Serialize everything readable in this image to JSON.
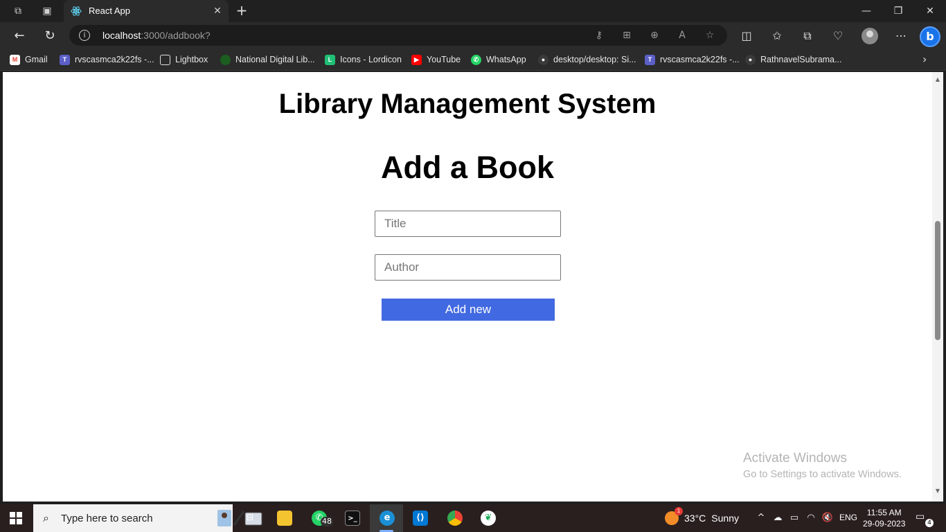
{
  "browser": {
    "tab_title": "React App",
    "url_host": "localhost",
    "url_path": ":3000/addbook?",
    "new_tab_symbol": "+",
    "close_symbol": "✕"
  },
  "bookmarks": [
    {
      "label": "Gmail",
      "icon": "gmail-icon",
      "color": "#ea4335"
    },
    {
      "label": "rvscasmca2k22fs -...",
      "icon": "teams-icon",
      "color": "#5b5fc7"
    },
    {
      "label": "Lightbox",
      "icon": "page-icon",
      "color": "#2b2b2b"
    },
    {
      "label": "National Digital Lib...",
      "icon": "ndl-icon",
      "color": "#1b5e20"
    },
    {
      "label": "Icons - Lordicon",
      "icon": "lordicon-icon",
      "color": "#1fbf75"
    },
    {
      "label": "YouTube",
      "icon": "youtube-icon",
      "color": "#ff0000"
    },
    {
      "label": "WhatsApp",
      "icon": "whatsapp-icon",
      "color": "#25d366"
    },
    {
      "label": "desktop/desktop: Si...",
      "icon": "github-icon",
      "color": "#3a3a3a"
    },
    {
      "label": "rvscasmca2k22fs -...",
      "icon": "teams-icon",
      "color": "#5b5fc7"
    },
    {
      "label": "RathnavelSubrama...",
      "icon": "github-icon",
      "color": "#3a3a3a"
    }
  ],
  "page": {
    "site_title": "Library Management System",
    "heading": "Add a Book",
    "title_placeholder": "Title",
    "author_placeholder": "Author",
    "submit_label": "Add new",
    "accent": "#4169e1"
  },
  "watermark": {
    "line1": "Activate Windows",
    "line2": "Go to Settings to activate Windows."
  },
  "taskbar": {
    "search_placeholder": "Type here to search",
    "whatsapp_badge": "48",
    "weather_temp": "33°C",
    "weather_text": "Sunny",
    "weather_alert": "1",
    "language": "ENG",
    "time": "11:55 AM",
    "date": "29-09-2023",
    "notification_count": "4"
  }
}
